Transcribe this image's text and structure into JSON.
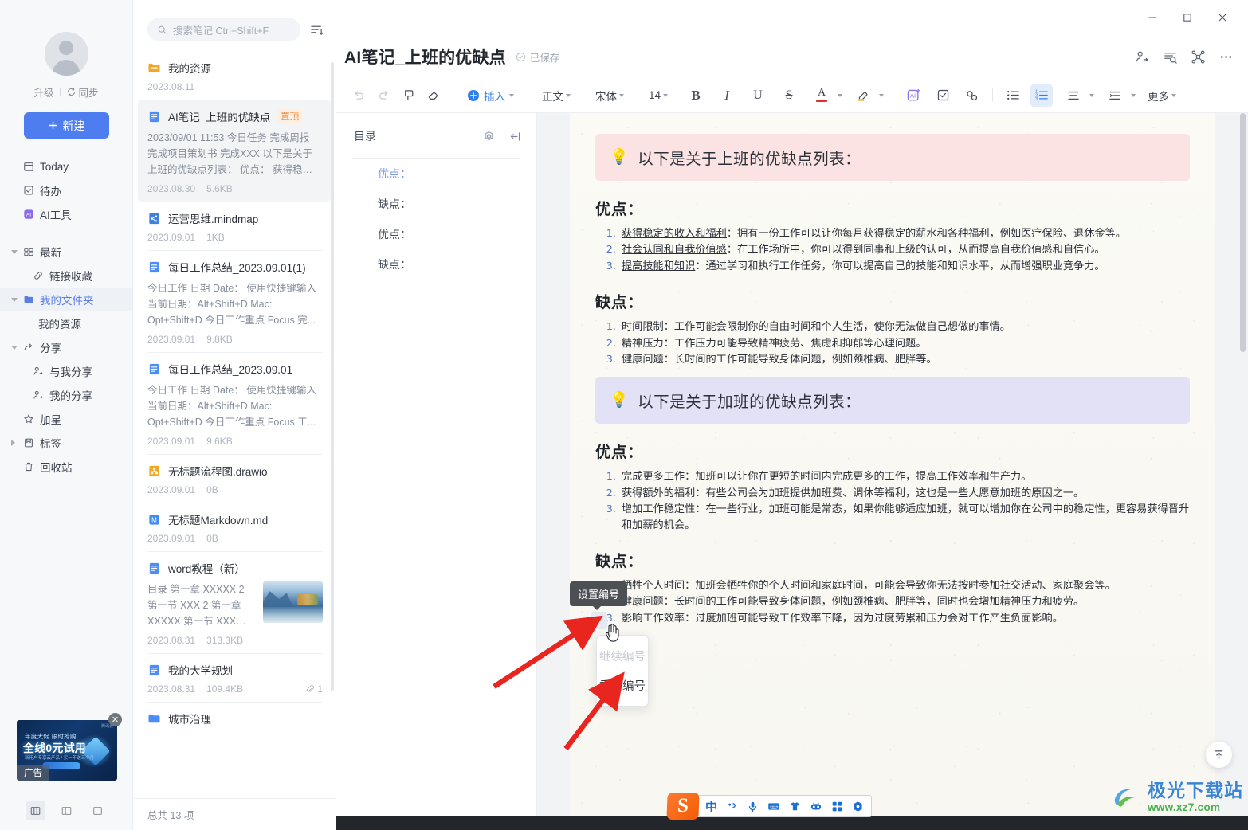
{
  "sidebar": {
    "account": {
      "upgrade": "升级",
      "sync": "同步"
    },
    "new_button": "新建",
    "items": [
      {
        "label": "Today",
        "icon": "calendar-icon"
      },
      {
        "label": "待办",
        "icon": "checkbox-icon"
      },
      {
        "label": "AI工具",
        "icon": "ai-icon"
      },
      {
        "label": "最新",
        "icon": "grid-icon"
      },
      {
        "label": "链接收藏",
        "icon": "link-icon"
      },
      {
        "label": "我的文件夹",
        "icon": "folder-icon"
      },
      {
        "label": "我的资源",
        "icon": "none"
      },
      {
        "label": "分享",
        "icon": "share-icon"
      },
      {
        "label": "与我分享",
        "icon": "user-in-icon"
      },
      {
        "label": "我的分享",
        "icon": "user-out-icon"
      },
      {
        "label": "加星",
        "icon": "star-icon"
      },
      {
        "label": "标签",
        "icon": "tag-icon"
      },
      {
        "label": "回收站",
        "icon": "trash-icon"
      }
    ],
    "ad": {
      "tag": "广告",
      "line1": "年度大促 限时抢购",
      "line2": "全线0元试用",
      "line3": "新用户专享云产品 / 买一年送三个月",
      "corner": "腾讯云"
    }
  },
  "filelist": {
    "search_placeholder": "搜索笔记 Ctrl+Shift+F",
    "footer": "总共 13 项",
    "items": [
      {
        "name": "我的资源",
        "icon": "folder-icon",
        "desc": "",
        "date": "2023.08.11",
        "size": "",
        "badge": "",
        "attach": ""
      },
      {
        "name": "AI笔记_上班的优缺点",
        "icon": "doc-icon",
        "badge": "置顶",
        "desc": "2023/09/01 11:53 今日任务 完成周报 完成项目策划书 完成XXX 以下是关于上班的优缺点列表： 优点： 获得稳定的收入...",
        "date": "2023.08.30",
        "size": "5.6KB",
        "attach": ""
      },
      {
        "name": "运营思维.mindmap",
        "icon": "mindmap-icon",
        "desc": "",
        "date": "2023.09.01",
        "size": "1KB",
        "badge": "",
        "attach": ""
      },
      {
        "name": "每日工作总结_2023.09.01(1)",
        "icon": "doc-icon",
        "desc": "今日工作 日期 Date： 使用快捷键输入当前日期：Alt+Shift+D Mac: Opt+Shift+D 今日工作重点 Focus 完...",
        "date": "2023.09.01",
        "size": "9.8KB",
        "badge": "",
        "attach": ""
      },
      {
        "name": "每日工作总结_2023.09.01",
        "icon": "doc-icon",
        "desc": "今日工作 日期 Date： 使用快捷键输入当前日期：Alt+Shift+D Mac: Opt+Shift+D 今日工作重点 Focus 工...",
        "date": "2023.09.01",
        "size": "9.6KB",
        "badge": "",
        "attach": ""
      },
      {
        "name": "无标题流程图.drawio",
        "icon": "drawio-icon",
        "desc": "",
        "date": "2023.09.01",
        "size": "0B",
        "badge": "",
        "attach": ""
      },
      {
        "name": "无标题Markdown.md",
        "icon": "markdown-icon",
        "desc": "",
        "date": "2023.09.01",
        "size": "0B",
        "badge": "",
        "attach": ""
      },
      {
        "name": "word教程（新）",
        "icon": "doc-icon",
        "desc": "目录 第一章 XXXXX 2 第一节 XXX 2 第一章 XXXXX 第一节 XXX 视...",
        "date": "2023.08.31",
        "size": "313.3KB",
        "badge": "",
        "attach": "",
        "thumb": "landscape-lake-thumbnail"
      },
      {
        "name": "我的大学规划",
        "icon": "doc-icon",
        "desc": "",
        "date": "2023.08.31",
        "size": "109.4KB",
        "badge": "",
        "attach": "1"
      },
      {
        "name": "城市治理",
        "icon": "folder-icon",
        "desc": "",
        "date": "",
        "size": "",
        "badge": "",
        "attach": ""
      }
    ]
  },
  "editor": {
    "title": "AI笔记_上班的优缺点",
    "saved_label": "已保存",
    "head_actions": [
      "share-user-icon",
      "find-icon",
      "mindmap-icon",
      "more-icon"
    ],
    "toolbar": {
      "undo": "undo-icon",
      "redo": "redo-icon",
      "comment": "comment-icon",
      "clear_format": "eraser-icon",
      "insert": "插入",
      "style": "正文",
      "font": "宋体",
      "size": "14",
      "bold": "B",
      "italic": "I",
      "underline": "U",
      "strike": "S",
      "font_color": "A",
      "highlight": "highlighter-icon",
      "ai": "ai-icon",
      "todo": "checkbox-icon",
      "link": "link-icon",
      "bullet_list": "bullet-list-icon",
      "ordered_list": "ordered-list-icon",
      "align": "align-icon",
      "indent": "indent-icon",
      "more": "更多"
    }
  },
  "toc": {
    "title": "目录",
    "items": [
      "优点：",
      "缺点：",
      "优点：",
      "缺点："
    ]
  },
  "document": {
    "callout1": "以下是关于上班的优缺点列表：",
    "section1_title": "优点：",
    "section1_items": [
      {
        "lead": "获得稳定的收入和福利",
        "text": "：拥有一份工作可以让你每月获得稳定的薪水和各种福利，例如医疗保险、退休金等。"
      },
      {
        "lead": "社会认同和自我价值感",
        "text": "：在工作场所中，你可以得到同事和上级的认可，从而提高自我价值感和自信心。"
      },
      {
        "lead": "提高技能和知识",
        "text": "：通过学习和执行工作任务，你可以提高自己的技能和知识水平，从而增强职业竞争力。"
      }
    ],
    "section2_title": "缺点：",
    "section2_items": [
      {
        "lead": "",
        "text": "时间限制：工作可能会限制你的自由时间和个人生活，使你无法做自己想做的事情。"
      },
      {
        "lead": "",
        "text": "精神压力：工作压力可能导致精神疲劳、焦虑和抑郁等心理问题。"
      },
      {
        "lead": "",
        "text": "健康问题：长时间的工作可能导致身体问题，例如颈椎病、肥胖等。"
      }
    ],
    "callout2": "以下是关于加班的优缺点列表：",
    "section3_title": "优点：",
    "section3_items": [
      {
        "lead": "",
        "text": "完成更多工作：加班可以让你在更短的时间内完成更多的工作，提高工作效率和生产力。"
      },
      {
        "lead": "",
        "text": "获得额外的福利：有些公司会为加班提供加班费、调休等福利，这也是一些人愿意加班的原因之一。"
      },
      {
        "lead": "",
        "text": "增加工作稳定性：在一些行业，加班可能是常态，如果你能够适应加班，就可以增加你在公司中的稳定性，更容易获得晋升和加薪的机会。"
      }
    ],
    "section4_title": "缺点：",
    "section4_items": [
      {
        "lead": "",
        "text": "牺牲个人时间：加班会牺牲你的个人时间和家庭时间，可能会导致你无法按时参加社交活动、家庭聚会等。"
      },
      {
        "lead": "",
        "text": "健康问题：长时间的工作可能导致身体问题，例如颈椎病、肥胖等，同时也会增加精神压力和疲劳。"
      },
      {
        "lead": "",
        "text": "影响工作效率：过度加班可能导致工作效率下降，因为过度劳累和压力会对工作产生负面影响。"
      }
    ]
  },
  "overlay": {
    "tooltip": "设置编号",
    "menu": [
      {
        "label": "继续编号",
        "disabled": true
      },
      {
        "label": "重新编号",
        "disabled": false
      }
    ]
  },
  "ime": {
    "logo": "S",
    "mode": "中",
    "items": [
      "punctuation-icon",
      "mic-icon",
      "keyboard-icon",
      "skin-icon",
      "emoji-icon",
      "apps-icon",
      "settings-icon"
    ]
  },
  "watermark": {
    "line1": "极光下载站",
    "line2": "www.xz7.com"
  },
  "window": {
    "minimize": "minimize-icon",
    "maximize": "maximize-icon",
    "close": "close-icon"
  },
  "colors": {
    "accent": "#4e7df0",
    "callout_pink": "#fbe3e3",
    "callout_purple": "#e2e1f5",
    "badge_orange": "#ef8a3c",
    "arrow_red": "#e8251f",
    "sidebar_bg": "#f7f8fa"
  }
}
